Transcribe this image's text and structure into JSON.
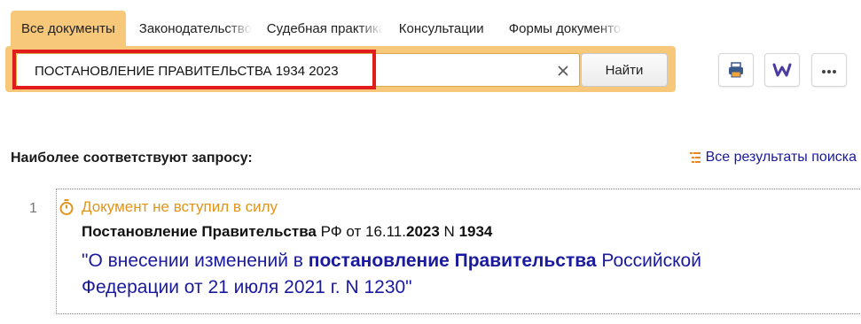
{
  "tabs": [
    {
      "label": "Все документы"
    },
    {
      "label": "Законодательство"
    },
    {
      "label": "Судебная практика"
    },
    {
      "label": "Консультации"
    },
    {
      "label": "Формы документов"
    }
  ],
  "search": {
    "query": "ПОСТАНОВЛЕНИЕ ПРАВИТЕЛЬСТВА 1934 2023",
    "find_label": "Найти"
  },
  "toolbar": {
    "print_icon": "printer-icon",
    "word_icon": "word-export-icon",
    "more_icon": "more-dots-icon"
  },
  "results": {
    "section_title": "Наиболее соответствуют запросу:",
    "all_results_label": "Все результаты поиска",
    "items": [
      {
        "number": "1",
        "status": "Документ не вступил в силу",
        "title_parts": {
          "t1": "Постановление Правительства",
          "t2": " РФ от 16.11.",
          "t3": "2023",
          "t4": " N ",
          "t5": "1934"
        },
        "link_parts": {
          "l1": "\"О внесении изменений в ",
          "l2": "постановление Правительства",
          "l3": " Российской Федерации от 21 июля 2021 г. N 1230\""
        }
      }
    ]
  },
  "colors": {
    "accent": "#f7c87a",
    "link": "#1a1a9e",
    "status": "#e0951a",
    "highlight": "#e21b1b"
  }
}
